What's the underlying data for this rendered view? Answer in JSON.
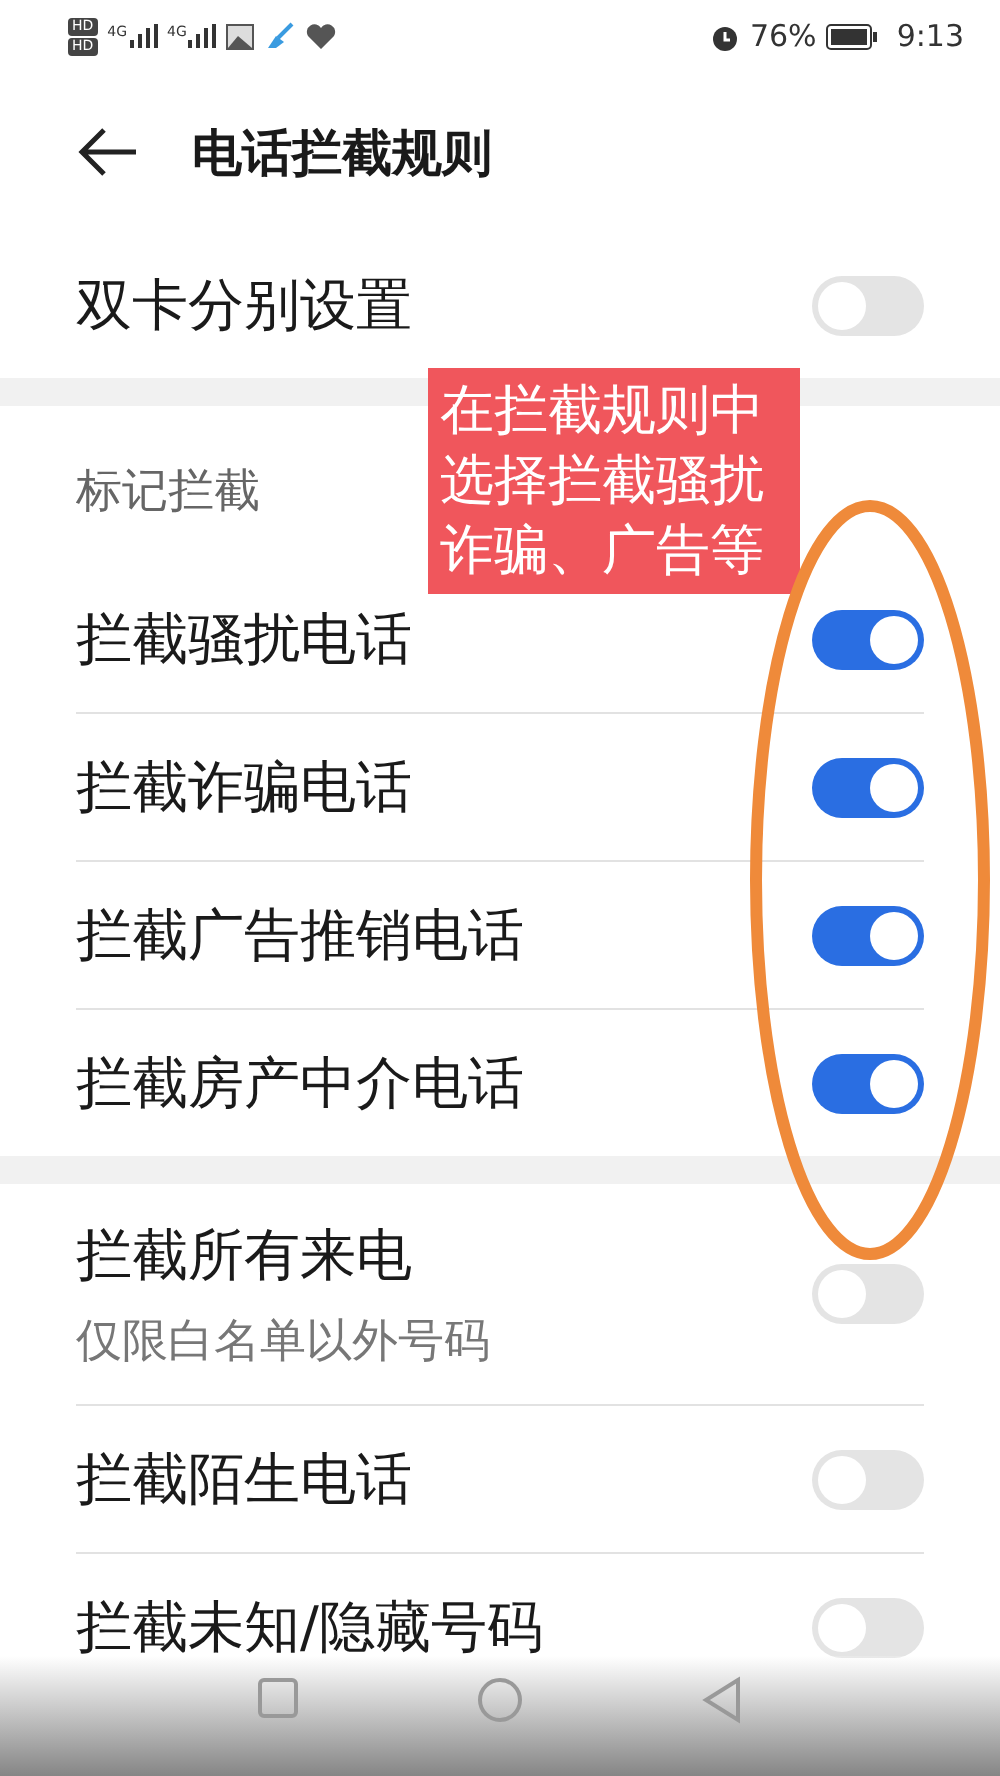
{
  "status_bar": {
    "sim_badges": [
      "HD",
      "HD"
    ],
    "network": [
      "4G",
      "4G"
    ],
    "battery": "76%",
    "time": "9:13"
  },
  "header": {
    "title": "电话拦截规则"
  },
  "sections": [
    {
      "items": [
        {
          "label": "双卡分别设置",
          "on": false
        }
      ]
    },
    {
      "header": "标记拦截",
      "items": [
        {
          "label": "拦截骚扰电话",
          "on": true
        },
        {
          "label": "拦截诈骗电话",
          "on": true
        },
        {
          "label": "拦截广告推销电话",
          "on": true
        },
        {
          "label": "拦截房产中介电话",
          "on": true
        }
      ]
    },
    {
      "items": [
        {
          "label": "拦截所有来电",
          "subtitle": "仅限白名单以外号码",
          "on": false
        },
        {
          "label": "拦截陌生电话",
          "on": false
        },
        {
          "label": "拦截未知/隐藏号码",
          "on": false
        }
      ]
    }
  ],
  "annotation": {
    "lines": [
      "在拦截规则中",
      "选择拦截骚扰",
      "诈骗、广告等"
    ]
  }
}
